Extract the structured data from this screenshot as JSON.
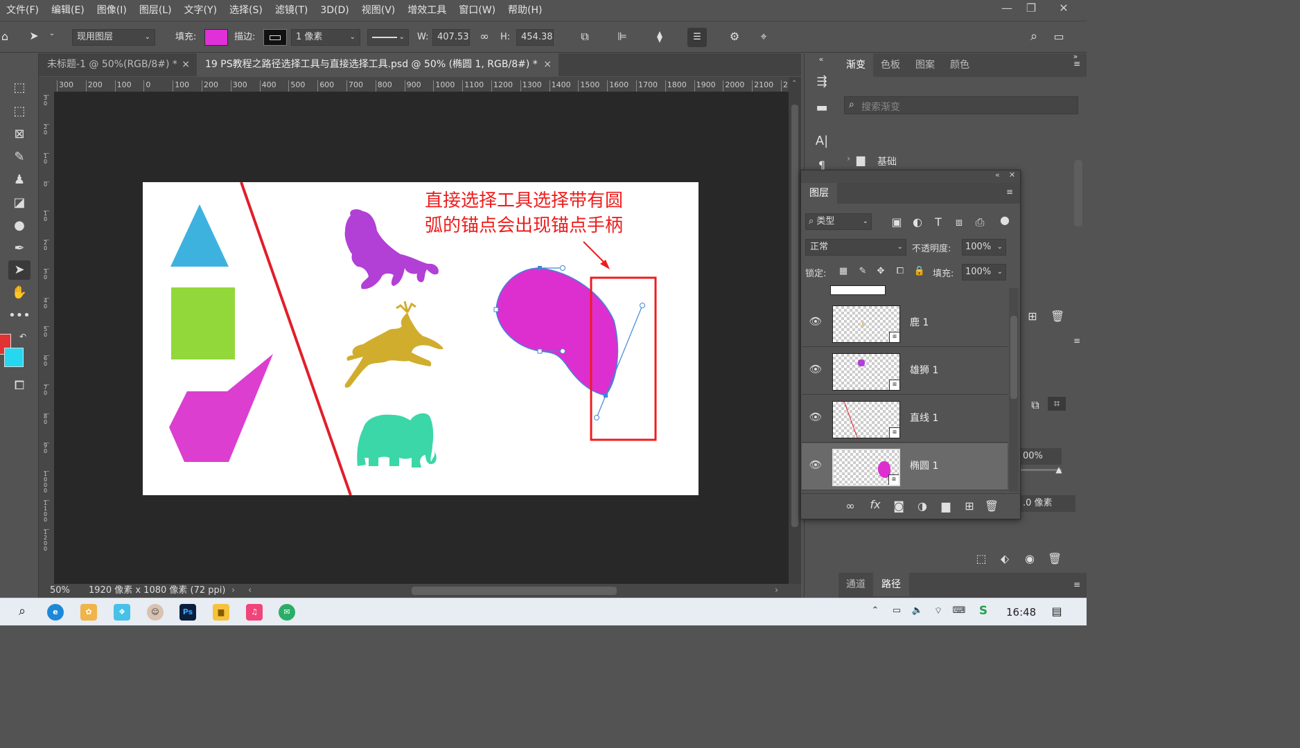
{
  "menubar": {
    "items": [
      "文件(F)",
      "编辑(E)",
      "图像(I)",
      "图层(L)",
      "文字(Y)",
      "选择(S)",
      "滤镜(T)",
      "3D(D)",
      "视图(V)",
      "增效工具",
      "窗口(W)",
      "帮助(H)"
    ]
  },
  "options": {
    "layer_select": "现用图层",
    "fill_label": "填充:",
    "fill_color": "#e030d8",
    "stroke_label": "描边:",
    "stroke_width": "1 像素",
    "w_label": "W:",
    "w_value": "407.53",
    "h_label": "H:",
    "h_value": "454.38"
  },
  "tabs": [
    {
      "label": "未标题-1 @ 50%(RGB/8#) *",
      "active": false
    },
    {
      "label": "19 PS教程之路径选择工具与直接选择工具.psd @ 50% (椭圆 1, RGB/8#) *",
      "active": true
    }
  ],
  "ruler_top_ticks": [
    "300",
    "200",
    "100",
    "0",
    "100",
    "200",
    "300",
    "400",
    "500",
    "600",
    "700",
    "800",
    "900",
    "1000",
    "1100",
    "1200",
    "1300",
    "1400",
    "1500",
    "1600",
    "1700",
    "1800",
    "1900",
    "2000",
    "2100",
    "2:"
  ],
  "ruler_left_ticks": [
    "3 0",
    "2 0",
    "1 0",
    "0",
    "1 0",
    "2 0",
    "3 0",
    "4 0",
    "5 0",
    "6 0",
    "7 0",
    "8 0",
    "9 0",
    "1 0 0 0",
    "1 1 0 0",
    "1 2 0 0"
  ],
  "annotation": {
    "line1": "直接选择工具选择带有圆",
    "line2": "弧的锚点会出现锚点手柄"
  },
  "colors": {
    "foreground": "#e23333",
    "background": "#26d7f0",
    "triangle": "#3db2df",
    "square": "#92d83a",
    "polygon": "#dc3fcf",
    "lion": "#b23fd6",
    "deer": "#d1ad2e",
    "elephant": "#3bd7a8",
    "ellipse": "#dd2fd0",
    "annotation_red": "#ef1c1c"
  },
  "status": {
    "zoom": "50%",
    "doc_info": "1920 像素 x 1080 像素 (72 ppi)"
  },
  "right_panel": {
    "tabs": [
      "渐变",
      "色板",
      "图案",
      "颜色"
    ],
    "search_placeholder": "搜索渐变",
    "folder": "基础",
    "opacity_partial": "00%",
    "pixels_partial": ".0 像素",
    "bottom_tabs": [
      "通道",
      "路径"
    ]
  },
  "layers_panel": {
    "title": "图层",
    "filter": "类型",
    "blend": "正常",
    "opacity_label": "不透明度:",
    "opacity": "100%",
    "lock_label": "锁定:",
    "fill_label": "填充:",
    "fill": "100%",
    "layers": [
      {
        "name": "鹿 1"
      },
      {
        "name": "雄狮 1"
      },
      {
        "name": "直线 1"
      },
      {
        "name": "椭圆 1",
        "selected": true
      }
    ]
  },
  "taskbar": {
    "time": "16:48"
  }
}
